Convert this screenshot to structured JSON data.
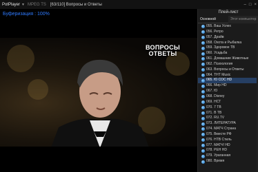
{
  "titlebar": {
    "app_name": "PotPlayer",
    "codec": "MPEG TS",
    "title": "[63/110] Вопросы и Ответы",
    "minimize": "–",
    "maximize": "□",
    "close": "×"
  },
  "video": {
    "overlay_text": "Буферизация : 100%",
    "logo_line1": "ВОПРОСЫ",
    "logo_line2": "ОТВЕТЫ"
  },
  "playlist": {
    "title": "Плей-лист",
    "tabs": [
      "Основной",
      "Этот компьютер"
    ],
    "selected_index": 10,
    "items": [
      "055. Ваш Успех",
      "056. Ретро",
      "057. Драйв",
      "058. Охота и Рыбалка",
      "059. Здоровое ТВ",
      "060. Усадьба",
      "061. Домашние Животные",
      "062. Психология",
      "063. Вопросы и Ответы",
      "064. ТНТ Music",
      "065. Ю СОС HD",
      "066. Мир HD",
      "067. Ю",
      "068. Disney",
      "069. НСТ",
      "070. 7 ТВ",
      "071. В ТВ",
      "072. RU.TV",
      "073. ЛИТЕРАТУРА",
      "074. МАТЧ Страна",
      "075. Вместе РФ",
      "076. НТВ Стиль",
      "077. МАТЧ! HD",
      "078. РЕН HD",
      "079. Ураганная",
      "080. Время"
    ]
  },
  "colors": {
    "overlay": "#2f7bff",
    "selected_row": "#263f63",
    "panel_bg": "#1b1b1b"
  }
}
